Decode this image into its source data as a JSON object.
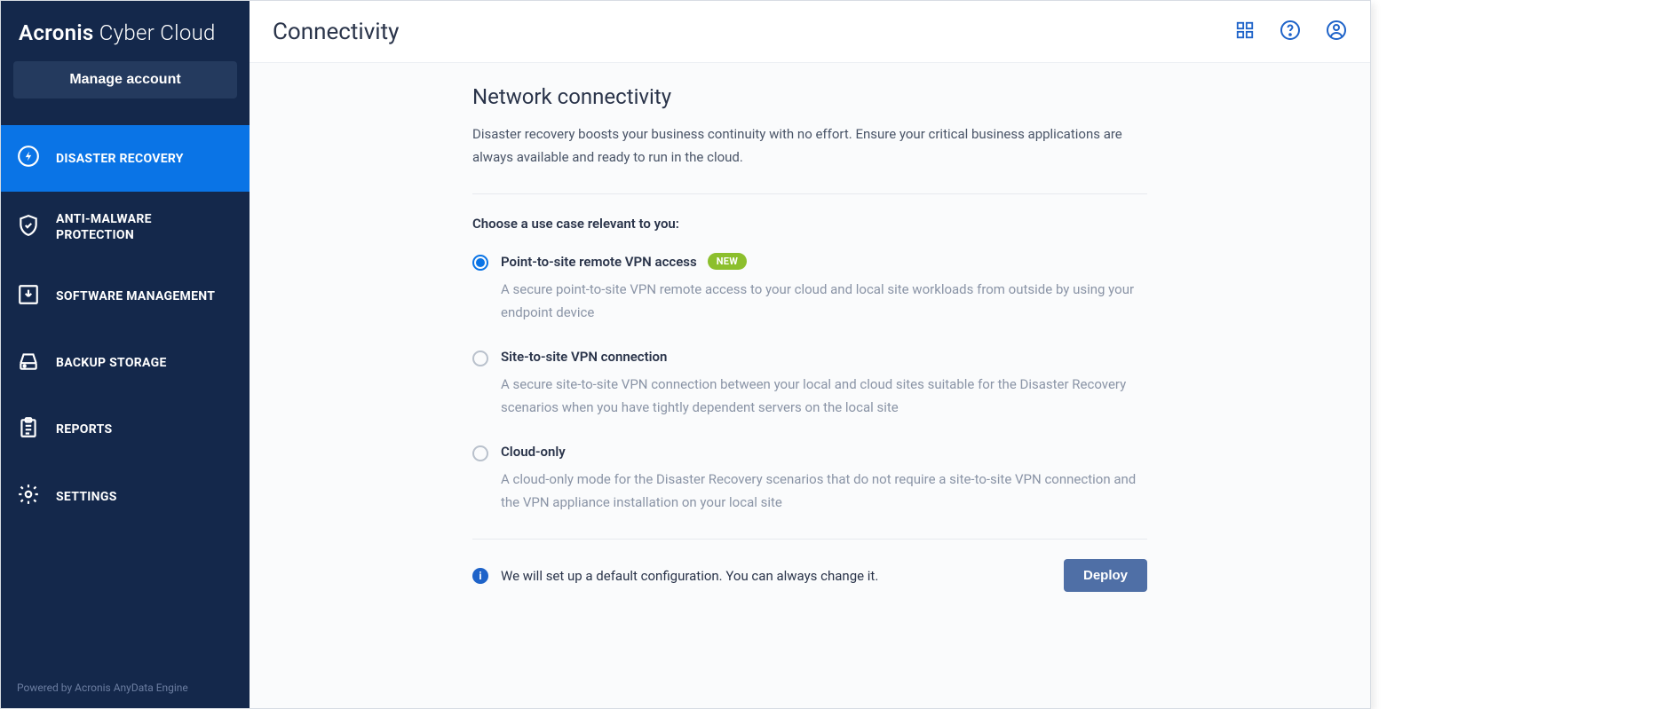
{
  "brand": {
    "bold": "Acronis",
    "light": "Cyber Cloud"
  },
  "sidebar": {
    "manage_label": "Manage account",
    "items": [
      {
        "label": "DISASTER RECOVERY"
      },
      {
        "label": "ANTI-MALWARE PROTECTION"
      },
      {
        "label": "SOFTWARE MANAGEMENT"
      },
      {
        "label": "BACKUP STORAGE"
      },
      {
        "label": "REPORTS"
      },
      {
        "label": "SETTINGS"
      }
    ],
    "powered": "Powered by Acronis AnyData Engine"
  },
  "header": {
    "title": "Connectivity"
  },
  "panel": {
    "title": "Network connectivity",
    "desc": "Disaster recovery boosts your business continuity with no effort. Ensure your critical business applications are always available and ready to run in the cloud.",
    "choose_label": "Choose a use case relevant to you:",
    "options": [
      {
        "title": "Point-to-site remote VPN access",
        "badge": "NEW",
        "desc": "A secure point-to-site VPN remote access to your cloud and local site workloads from outside by using your endpoint device",
        "selected": true
      },
      {
        "title": "Site-to-site VPN connection",
        "desc": "A secure site-to-site VPN connection between your local and cloud sites suitable for the Disaster Recovery scenarios when you have tightly dependent servers on the local site",
        "selected": false
      },
      {
        "title": "Cloud-only",
        "desc": "A cloud-only mode for the Disaster Recovery scenarios that do not require a site-to-site VPN connection and the VPN appliance installation on your local site",
        "selected": false
      }
    ],
    "footer_text": "We will set up a default configuration. You can always change it.",
    "deploy_label": "Deploy"
  }
}
